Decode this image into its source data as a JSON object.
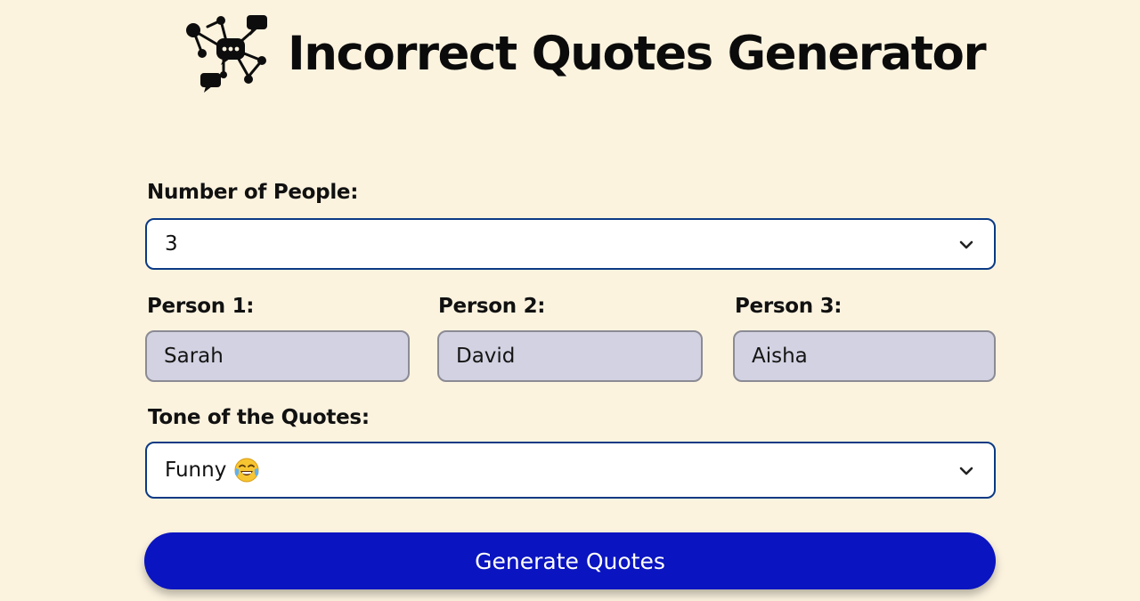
{
  "header": {
    "title": "Incorrect Quotes Generator",
    "logo_icon": "chat-network-icon"
  },
  "form": {
    "people_count": {
      "label": "Number of People:",
      "value": "3",
      "icon": "chevron-down-icon"
    },
    "persons": [
      {
        "label": "Person 1:",
        "value": "Sarah"
      },
      {
        "label": "Person 2:",
        "value": "David"
      },
      {
        "label": "Person 3:",
        "value": "Aisha"
      }
    ],
    "tone": {
      "label": "Tone of the Quotes:",
      "value": "Funny",
      "emoji": "tears-of-joy-emoji",
      "icon": "chevron-down-icon"
    },
    "generate_label": "Generate Quotes"
  },
  "colors": {
    "background": "#fcf3df",
    "accent": "#0a14c0",
    "select_border": "#0b3a84",
    "input_fill": "#d2d2e2"
  }
}
